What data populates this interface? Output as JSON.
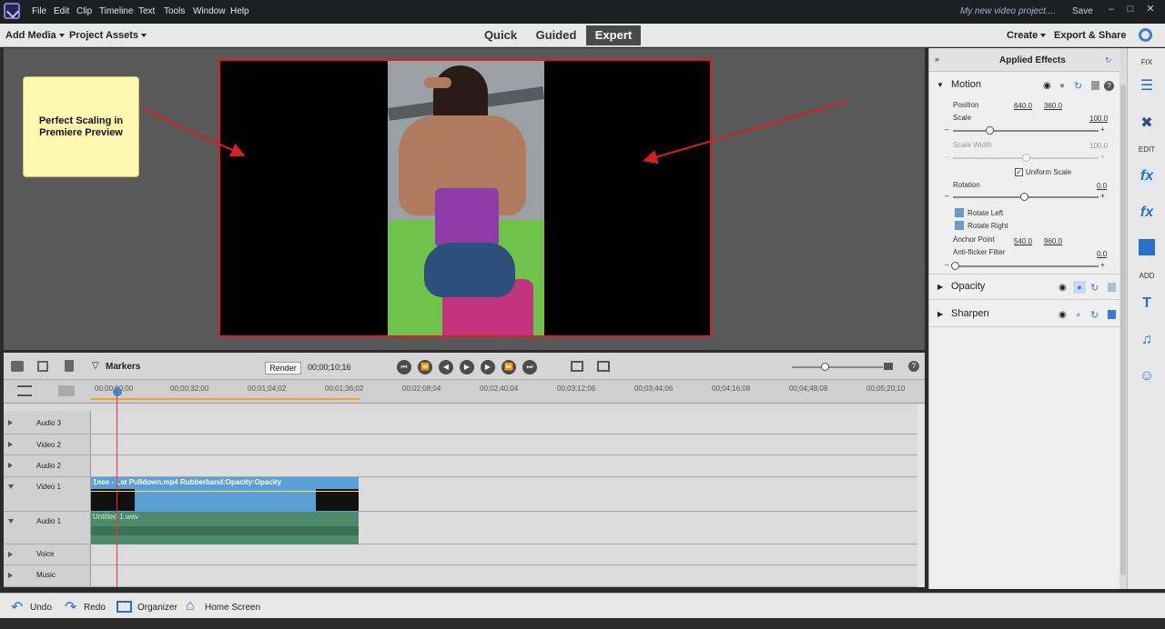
{
  "menubar": {
    "items": [
      "File",
      "Edit",
      "Clip",
      "Timeline",
      "Text",
      "Tools",
      "Window",
      "Help"
    ],
    "project_name": "My new video project....",
    "save_label": "Save"
  },
  "toolbar": {
    "add_media": "Add Media",
    "project_assets": "Project Assets",
    "modes": [
      "Quick",
      "Guided",
      "Expert"
    ],
    "create": "Create",
    "export_share": "Export & Share"
  },
  "monitor": {
    "note_line1": "Perfect Scaling in",
    "note_line2": "Premiere Preview"
  },
  "timeline_controls": {
    "markers": "Markers",
    "render": "Render",
    "timecode": "00;00;10;16"
  },
  "ruler": {
    "ticks": [
      "00;00;00;00",
      "00;00;32;00",
      "00;01;04;02",
      "00;01;36;02",
      "00;02;08;04",
      "00;02;40;04",
      "00;03;12;06",
      "00;03;44;06",
      "00;04;16;08",
      "00;04;48;08",
      "00;05;20;10"
    ]
  },
  "tracks": {
    "audio3": "Audio 3",
    "video2": "Video 2",
    "audio2": "Audio 2",
    "video1": "Video 1",
    "audio1": "Audio 1",
    "voice": "Voice",
    "music": "Music",
    "video_clip": "1nes - Lat Pulldown.mp4 Rubberband:Opacity:Opacity",
    "audio_clip": "Untitled 1.wav"
  },
  "bottombar": {
    "undo": "Undo",
    "redo": "Redo",
    "organizer": "Organizer",
    "home": "Home Screen"
  },
  "panel": {
    "title": "Applied Effects",
    "motion": "Motion",
    "position_label": "Position",
    "position_x": "640.0",
    "position_y": "360.0",
    "scale_label": "Scale",
    "scale_value": "100.0",
    "scale_width_label": "Scale Width",
    "scale_width_value": "100.0",
    "uniform_scale": "Uniform Scale",
    "rotation_label": "Rotation",
    "rotation_value": "0.0",
    "rotate_left": "Rotate Left",
    "rotate_right": "Rotate Right",
    "anchor_label": "Anchor Point",
    "anchor_x": "540.0",
    "anchor_y": "960.0",
    "antiflicker_label": "Anti-flicker Filter",
    "antiflicker_value": "0.0",
    "opacity": "Opacity",
    "sharpen": "Sharpen"
  },
  "sidebar": {
    "fix": "FIX",
    "edit": "EDIT",
    "add": "ADD"
  }
}
